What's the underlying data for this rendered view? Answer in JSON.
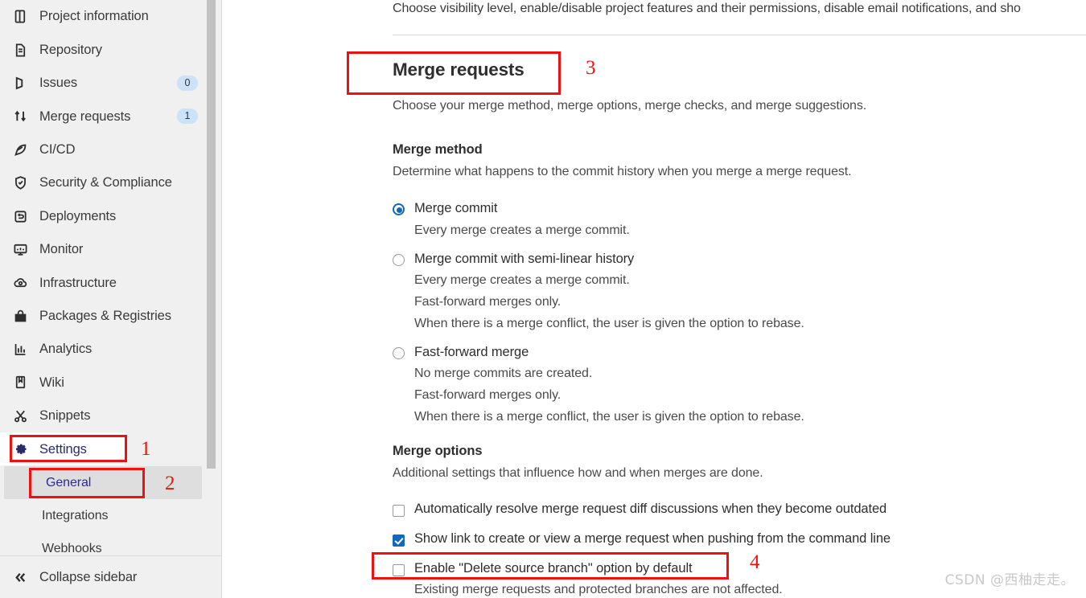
{
  "sidebar": {
    "items": [
      {
        "label": "Project information",
        "icon": "project-information-icon",
        "badge": null
      },
      {
        "label": "Repository",
        "icon": "repository-icon",
        "badge": null
      },
      {
        "label": "Issues",
        "icon": "issues-icon",
        "badge": "0"
      },
      {
        "label": "Merge requests",
        "icon": "merge-requests-icon",
        "badge": "1"
      },
      {
        "label": "CI/CD",
        "icon": "cicd-icon",
        "badge": null
      },
      {
        "label": "Security & Compliance",
        "icon": "shield-icon",
        "badge": null
      },
      {
        "label": "Deployments",
        "icon": "deployments-icon",
        "badge": null
      },
      {
        "label": "Monitor",
        "icon": "monitor-icon",
        "badge": null
      },
      {
        "label": "Infrastructure",
        "icon": "infrastructure-icon",
        "badge": null
      },
      {
        "label": "Packages & Registries",
        "icon": "packages-icon",
        "badge": null
      },
      {
        "label": "Analytics",
        "icon": "analytics-icon",
        "badge": null
      },
      {
        "label": "Wiki",
        "icon": "wiki-icon",
        "badge": null
      },
      {
        "label": "Snippets",
        "icon": "snippets-icon",
        "badge": null
      },
      {
        "label": "Settings",
        "icon": "gear-icon",
        "badge": null
      }
    ],
    "settings_subitems": [
      {
        "label": "General",
        "active": true
      },
      {
        "label": "Integrations",
        "active": false
      },
      {
        "label": "Webhooks",
        "active": false
      }
    ],
    "collapse": {
      "label": "Collapse sidebar",
      "icon": "double-chevron-left-icon"
    }
  },
  "main": {
    "intro_text": "Choose visibility level, enable/disable project features and their permissions, disable email notifications, and sho",
    "section_title": "Merge requests",
    "section_subtitle": "Choose your merge method, merge options, merge checks, and merge suggestions.",
    "merge_method": {
      "title": "Merge method",
      "subtitle": "Determine what happens to the commit history when you merge a merge request.",
      "options": [
        {
          "label": "Merge commit",
          "selected": true,
          "description": [
            "Every merge creates a merge commit."
          ]
        },
        {
          "label": "Merge commit with semi-linear history",
          "selected": false,
          "description": [
            "Every merge creates a merge commit.",
            "Fast-forward merges only.",
            "When there is a merge conflict, the user is given the option to rebase."
          ]
        },
        {
          "label": "Fast-forward merge",
          "selected": false,
          "description": [
            "No merge commits are created.",
            "Fast-forward merges only.",
            "When there is a merge conflict, the user is given the option to rebase."
          ]
        }
      ]
    },
    "merge_options": {
      "title": "Merge options",
      "subtitle": "Additional settings that influence how and when merges are done.",
      "checkboxes": [
        {
          "label": "Automatically resolve merge request diff discussions when they become outdated",
          "checked": false,
          "description": null
        },
        {
          "label": "Show link to create or view a merge request when pushing from the command line",
          "checked": true,
          "description": null
        },
        {
          "label": "Enable \"Delete source branch\" option by default",
          "checked": false,
          "description": "Existing merge requests and protected branches are not affected."
        }
      ]
    }
  },
  "annotations": {
    "color": "#ee1111",
    "numbers": [
      "1",
      "2",
      "3",
      "4"
    ]
  },
  "watermark": "CSDN @西柚走走。"
}
